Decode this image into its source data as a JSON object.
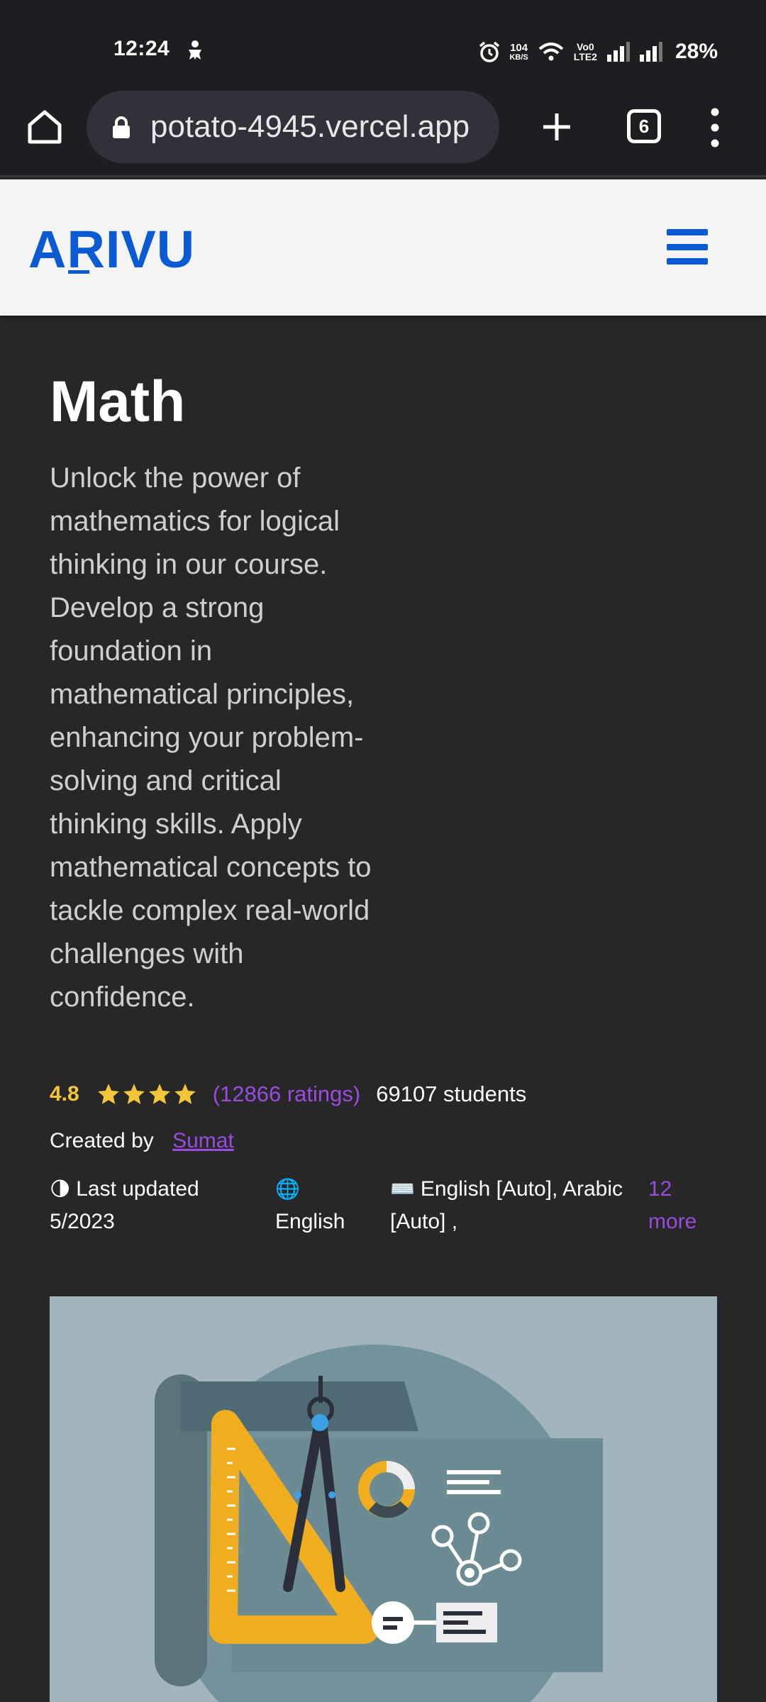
{
  "status_bar": {
    "time": "12:24",
    "network_speed_value": "104",
    "network_speed_unit": "KB/S",
    "volte_label_top": "Vo0",
    "volte_label_bottom": "LTE2",
    "battery": "28%"
  },
  "browser": {
    "url": "potato-4945.vercel.app",
    "tab_count": "6"
  },
  "site_header": {
    "logo": "ARIVU"
  },
  "course": {
    "title": "Math",
    "description": "Unlock the power of mathematics for logical thinking in our course. Develop a strong foundation in mathematical principles, enhancing your problem-solving and critical thinking skills. Apply mathematical concepts to tackle complex real-world challenges with confidence.",
    "rating_value": "4.8",
    "stars_count": 4,
    "ratings_count": "(12866 ratings)",
    "students": "69107 students",
    "created_by_label": "Created by",
    "author": "Sumat",
    "last_updated_label": "Last updated",
    "last_updated_date": "5/2023",
    "language": "English",
    "captions": "English [Auto], Arabic [Auto] ,",
    "captions_more": "12 more"
  },
  "colors": {
    "accent": "#0a5bd3",
    "link": "#9a4be0",
    "star": "#f3c63a",
    "background": "#272727"
  }
}
